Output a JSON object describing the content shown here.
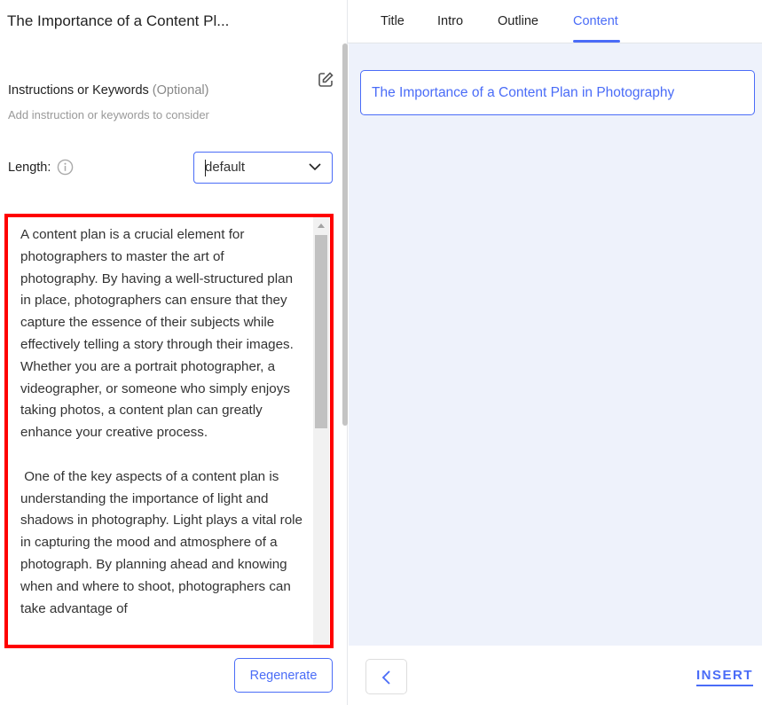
{
  "header": {
    "doc_title": "The Importance of a Content Pl..."
  },
  "tabs": [
    {
      "label": "Title"
    },
    {
      "label": "Intro"
    },
    {
      "label": "Outline"
    },
    {
      "label": "Content",
      "active": true
    }
  ],
  "instructions": {
    "label": "Instructions or Keywords",
    "optional": "(Optional)",
    "hint": "Add instruction or keywords to consider"
  },
  "length": {
    "label": "Length:",
    "value": "default"
  },
  "content_text": "A content plan is a crucial element for photographers to master the art of photography. By having a well-structured plan in place, photographers can ensure that they capture the essence of their subjects while effectively telling a story through their images. Whether you are a portrait photographer, a videographer, or someone who simply enjoys taking photos, a content plan can greatly enhance your creative process.\n\n One of the key aspects of a content plan is understanding the importance of light and shadows in photography. Light plays a vital role in capturing the mood and atmosphere of a photograph. By planning ahead and knowing when and where to shoot, photographers can take advantage of",
  "buttons": {
    "regenerate": "Regenerate",
    "insert": "INSERT"
  },
  "right": {
    "title": "The Importance of a Content Plan in Photography"
  },
  "colors": {
    "accent": "#4a6cf7",
    "highlight": "#ff0000",
    "panel_bg": "#eef2fb"
  }
}
